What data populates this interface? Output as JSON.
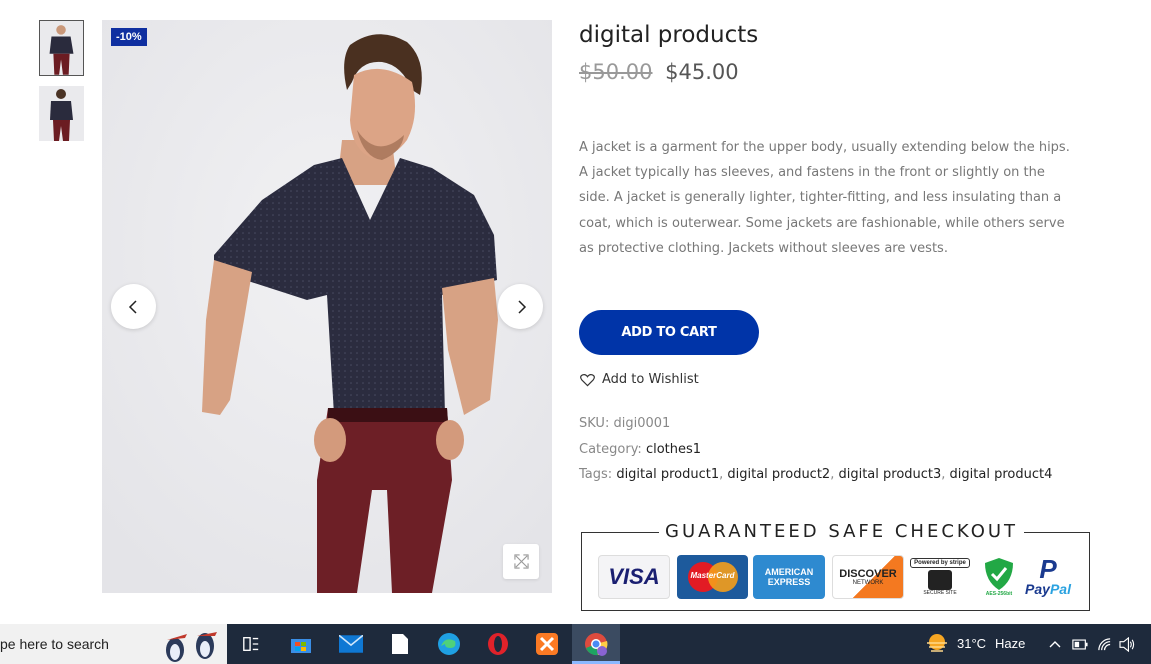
{
  "product": {
    "title": "digital products",
    "old_price": "$50.00",
    "new_price": "$45.00",
    "discount_badge": "-10%",
    "description": "A jacket is a garment for the upper body, usually extending below the hips. A jacket typically has sleeves, and fastens in the front or slightly on the side. A jacket is generally lighter, tighter-fitting, and less insulating than a coat, which is outerwear. Some jackets are fashionable, while others serve as protective clothing. Jackets without sleeves are vests.",
    "add_to_cart_label": "ADD TO CART",
    "wishlist_label": "Add to Wishlist",
    "sku_label": "SKU:",
    "sku_value": "digi0001",
    "category_label": "Category:",
    "category_value": "clothes1",
    "tags_label": "Tags:",
    "tags": [
      "digital product1",
      "digital product2",
      "digital product3",
      "digital product4"
    ],
    "tag_separator": ", "
  },
  "checkout": {
    "title": "GUARANTEED SAFE CHECKOUT",
    "badges": {
      "visa": "VISA",
      "mastercard": "MasterCard",
      "amex_line1": "AMERICAN",
      "amex_line2": "EXPRESS",
      "discover_line1": "DISCOVER",
      "discover_line2": "NETWORK",
      "stripe_top": "Powered by stripe",
      "stripe_bottom": "SECURE SITE",
      "aes": "AES-256bit",
      "paypal_pay": "Pay",
      "paypal_pal": "Pal"
    }
  },
  "taskbar": {
    "search_placeholder": "pe here to search",
    "weather_temp": "31°C",
    "weather_condition": "Haze",
    "icons": [
      "task-view-icon",
      "store-icon",
      "mail-icon",
      "file-icon",
      "edge-icon",
      "opera-icon",
      "xampp-icon",
      "chrome-icon"
    ]
  },
  "colors": {
    "accent": "#0034a8",
    "badge": "#0f2fa0",
    "taskbar": "#1e2a3c"
  }
}
